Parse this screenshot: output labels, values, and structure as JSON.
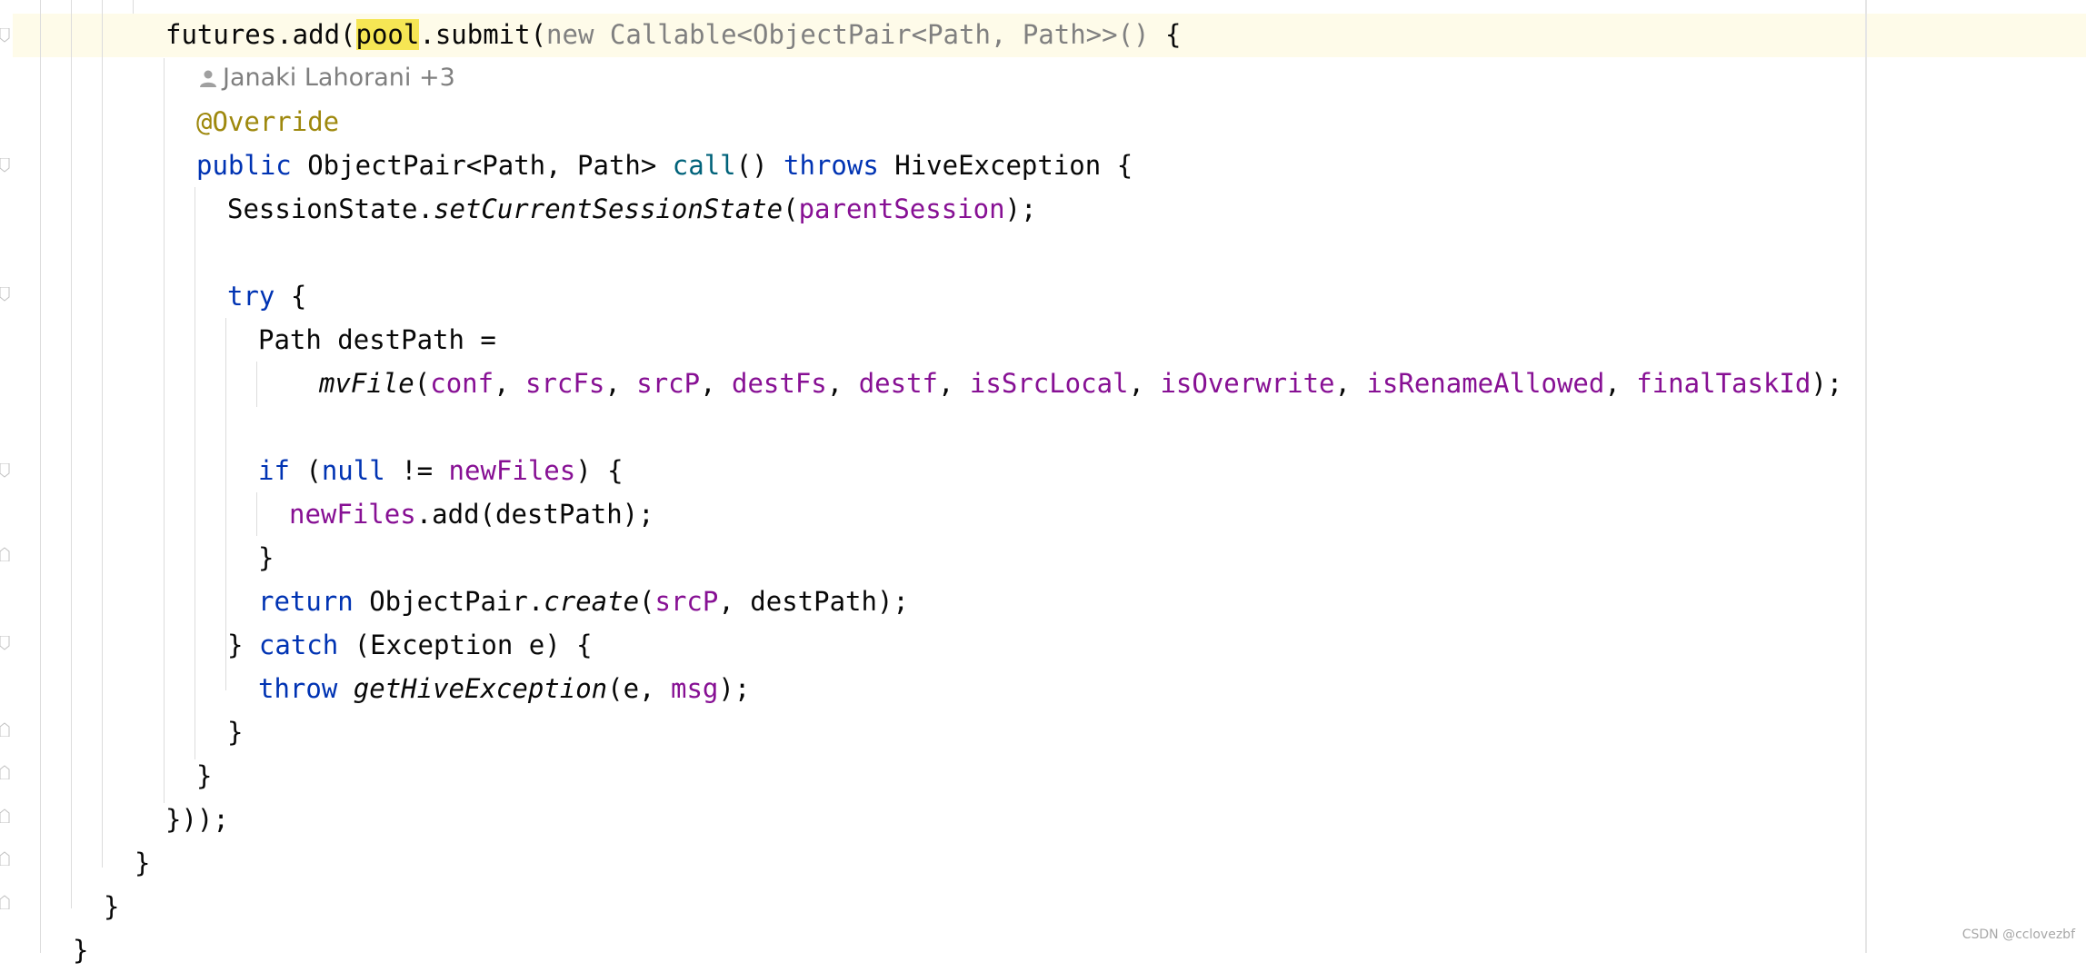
{
  "editor": {
    "code_hint": {
      "author": "Janaki Lahorani +3"
    },
    "lines": {
      "l1": {
        "a": "futures.add(",
        "b": "pool",
        "c": ".submit(",
        "d": "new Callable<ObjectPair<Path, Path>>() ",
        "e": "{"
      },
      "l2": {
        "a": "@Override"
      },
      "l3": {
        "a": "public",
        "b": " ObjectPair<Path, Path> ",
        "c": "call",
        "d": "() ",
        "e": "throws",
        "f": " HiveException {"
      },
      "l4": {
        "a": "SessionState.",
        "b": "setCurrentSessionState",
        "c": "(",
        "d": "parentSession",
        "e": ");"
      },
      "l5": {
        "a": "try",
        "b": " {"
      },
      "l6": {
        "a": "Path destPath ="
      },
      "l7": {
        "a": "mvFile",
        "b": "(",
        "c": "conf",
        "d": ", ",
        "e": "srcFs",
        "f": ", ",
        "g": "srcP",
        "h": ", ",
        "i": "destFs",
        "j": ", ",
        "k": "destf",
        "l": ", ",
        "m": "isSrcLocal",
        "n": ", ",
        "o": "isOverwrite",
        "p": ", ",
        "q": "isRenameAllowed",
        "r": ", ",
        "s": "finalTaskId",
        "t": ");"
      },
      "l8": {
        "a": "if",
        "b": " (",
        "c": "null",
        "d": " != ",
        "e": "newFiles",
        "f": ") {"
      },
      "l9": {
        "a": "newFiles",
        "b": ".add(destPath);"
      },
      "l10": {
        "a": "}"
      },
      "l11": {
        "a": "return",
        "b": " ObjectPair.",
        "c": "create",
        "d": "(",
        "e": "srcP",
        "f": ", destPath);"
      },
      "l12": {
        "a": "} ",
        "b": "catch",
        "c": " (Exception e) {"
      },
      "l13": {
        "a": "throw",
        "b": " ",
        "c": "getHiveException",
        "d": "(e, ",
        "e": "msg",
        "f": ");"
      },
      "l14": {
        "a": "}"
      },
      "l15": {
        "a": "}"
      },
      "l16": {
        "a": "}));"
      },
      "l17": {
        "a": "}"
      },
      "l18": {
        "a": "}"
      },
      "l19": {
        "a": "}"
      }
    }
  },
  "watermark": "CSDN @cclovezbf",
  "colors": {
    "keyword": "#0033b3",
    "field": "#871094",
    "annotation": "#9e880d",
    "method_call": "#00627a",
    "default_text": "#080808",
    "hint_gray": "#7f7f7f",
    "current_line_bg": "#fefbe9",
    "identifier_highlight": "#f6e654"
  }
}
